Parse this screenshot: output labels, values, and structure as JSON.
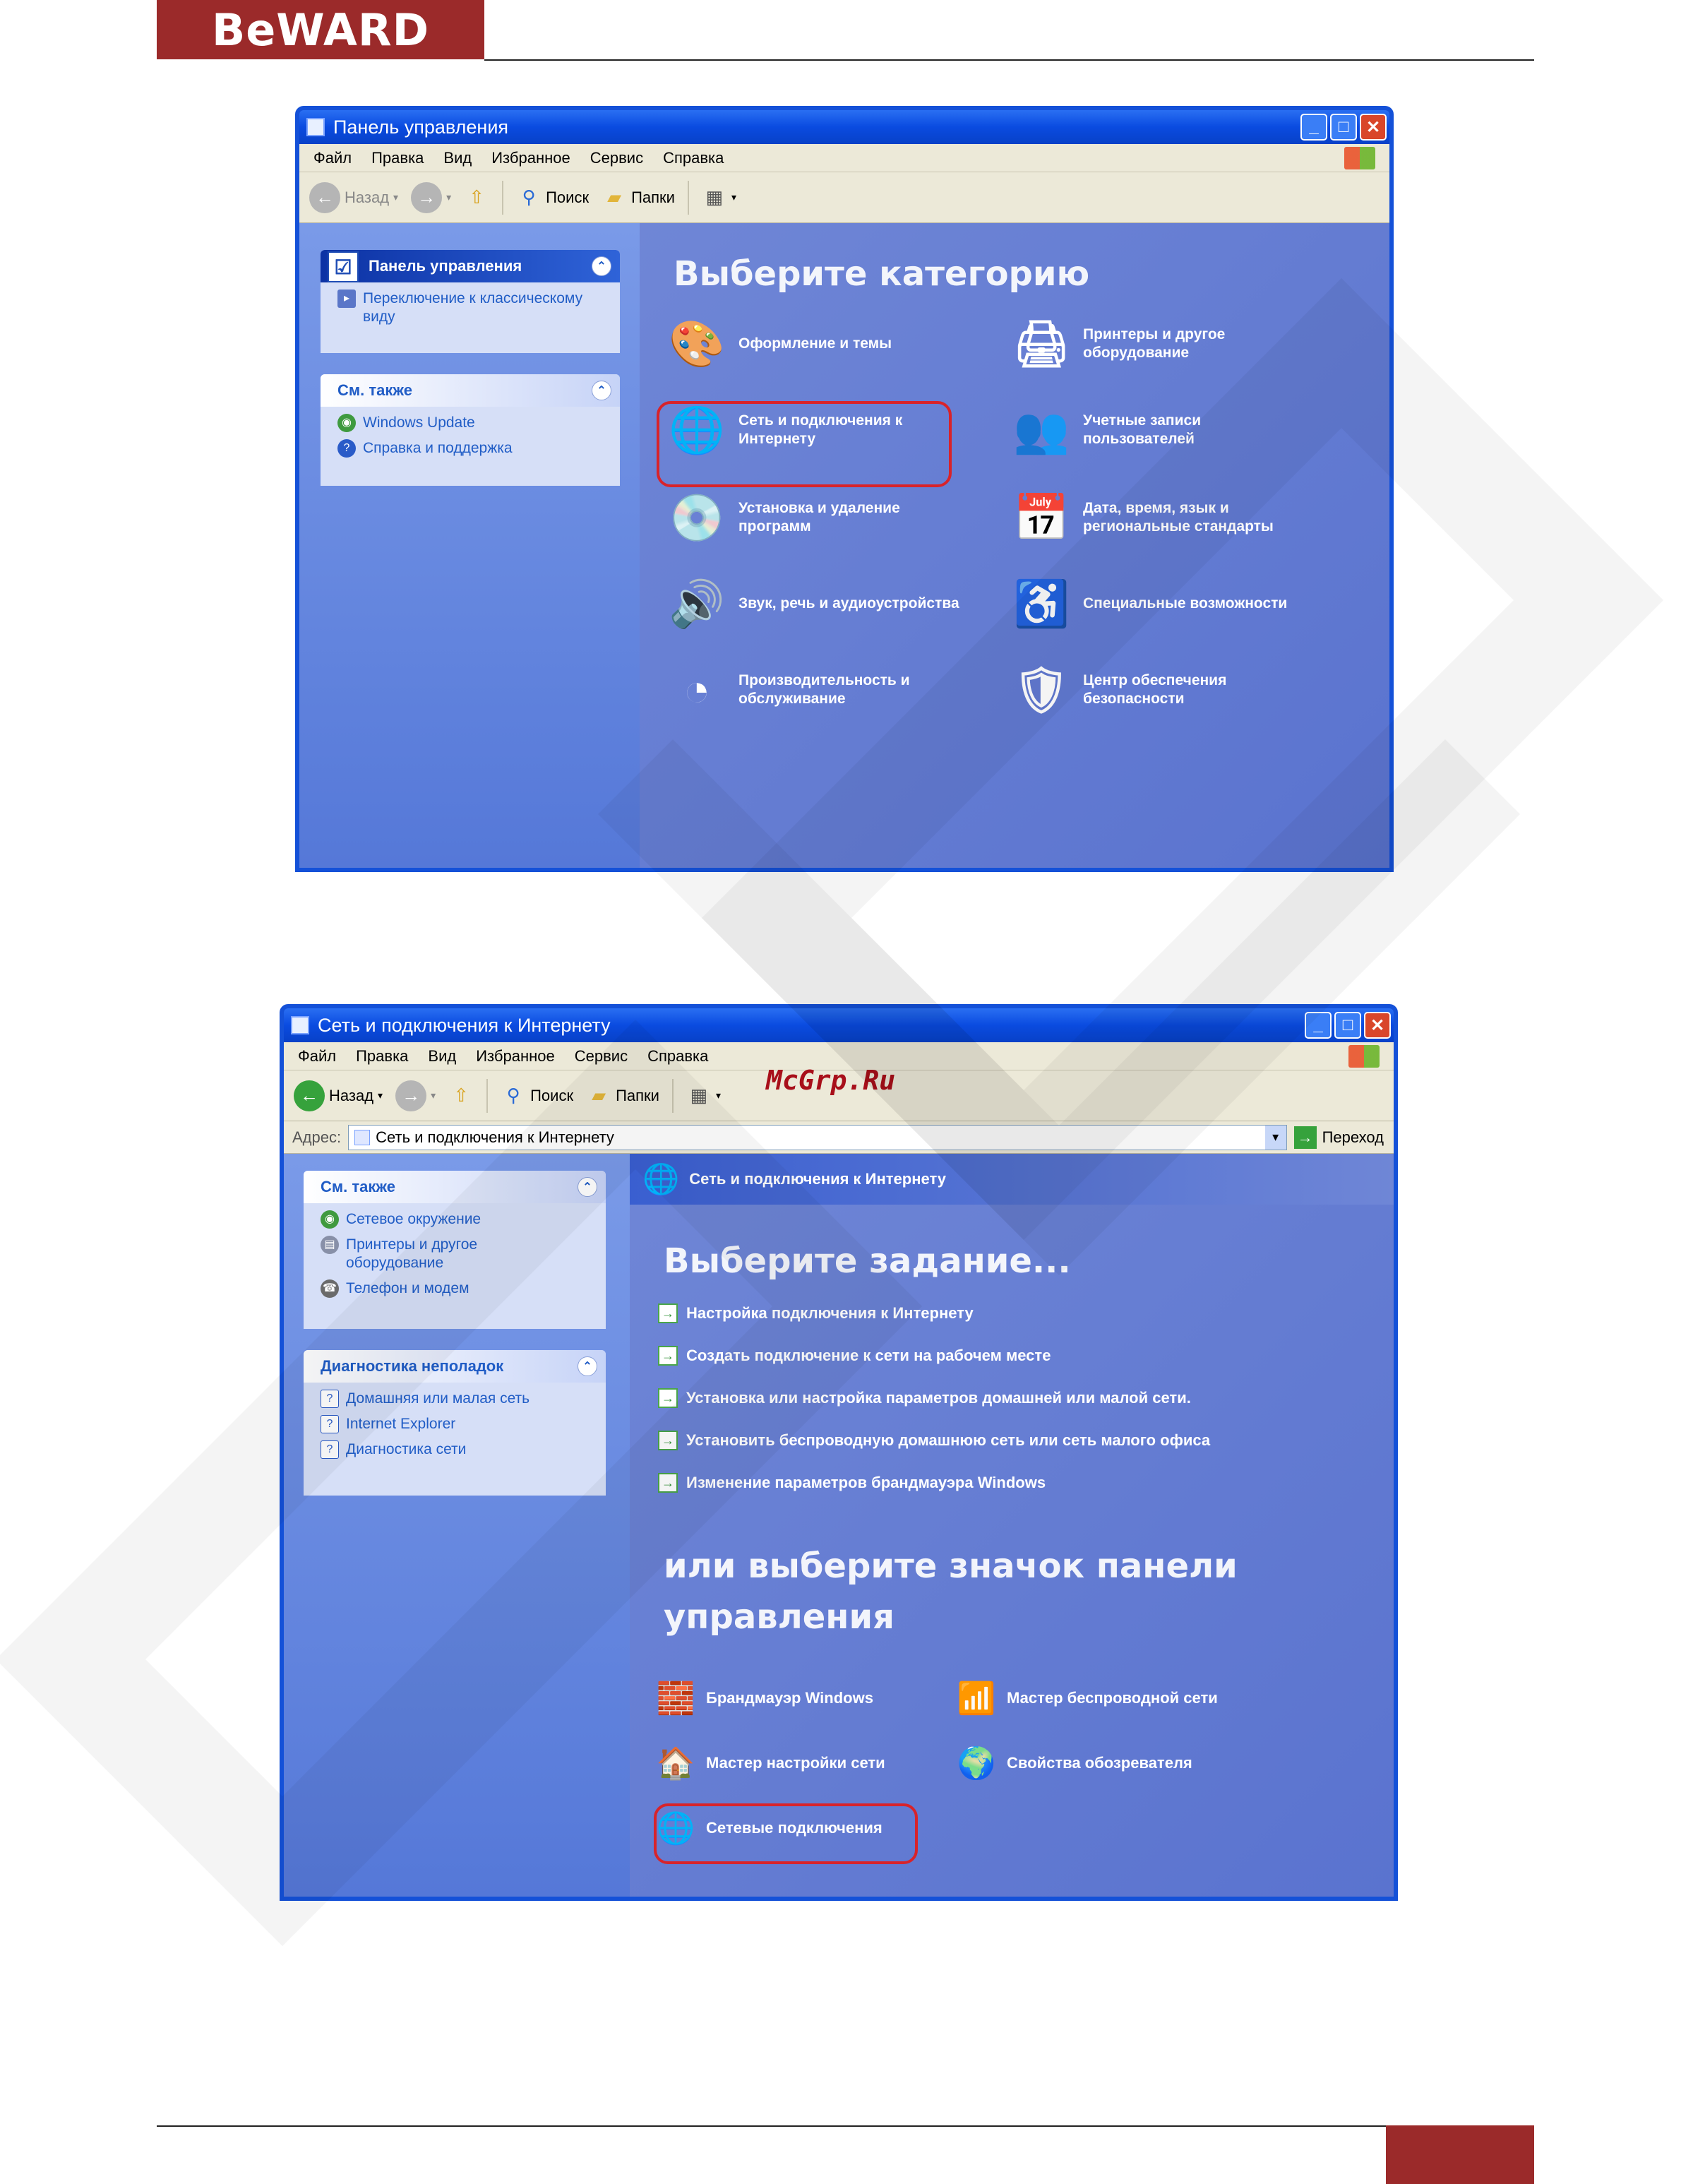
{
  "brand": {
    "logo_text": "BeWARD"
  },
  "watermark": {
    "text": "McGrp.Ru"
  },
  "window1": {
    "title": "Панель управления",
    "menu": [
      "Файл",
      "Правка",
      "Вид",
      "Избранное",
      "Сервис",
      "Справка"
    ],
    "toolbar": {
      "back": "Назад",
      "search": "Поиск",
      "folders": "Папки"
    },
    "left": {
      "panel1_title": "Панель управления",
      "panel1_items": [
        "Переключение к классическому виду"
      ],
      "panel2_title": "См. также",
      "panel2_items": [
        "Windows Update",
        "Справка и поддержка"
      ]
    },
    "heading": "Выберите категорию",
    "categories": [
      {
        "label": "Оформление и темы",
        "icon": "appearance-icon"
      },
      {
        "label": "Принтеры и другое оборудование",
        "icon": "printer-icon"
      },
      {
        "label": "Сеть и подключения к Интернету",
        "icon": "network-icon"
      },
      {
        "label": "Учетные записи пользователей",
        "icon": "users-icon"
      },
      {
        "label": "Установка и удаление программ",
        "icon": "add-remove-icon"
      },
      {
        "label": "Дата, время, язык и региональные стандарты",
        "icon": "date-time-icon"
      },
      {
        "label": "Звук, речь и аудиоустройства",
        "icon": "sound-icon"
      },
      {
        "label": "Специальные возможности",
        "icon": "accessibility-icon"
      },
      {
        "label": "Производительность и обслуживание",
        "icon": "performance-icon"
      },
      {
        "label": "Центр обеспечения безопасности",
        "icon": "security-center-icon"
      }
    ]
  },
  "window2": {
    "title": "Сеть и подключения к Интернету",
    "menu": [
      "Файл",
      "Правка",
      "Вид",
      "Избранное",
      "Сервис",
      "Справка"
    ],
    "toolbar": {
      "back": "Назад",
      "search": "Поиск",
      "folders": "Папки"
    },
    "address": {
      "label": "Адрес:",
      "value": "Сеть и подключения к Интернету",
      "go": "Переход"
    },
    "left": {
      "panel1_title": "См. также",
      "panel1_items": [
        "Сетевое окружение",
        "Принтеры и другое оборудование",
        "Телефон и модем"
      ],
      "panel2_title": "Диагностика неполадок",
      "panel2_items": [
        "Домашняя или малая сеть",
        "Internet Explorer",
        "Диагностика сети"
      ]
    },
    "section_header": "Сеть и подключения к Интернету",
    "task_heading": "Выберите задание...",
    "tasks": [
      "Настройка подключения к Интернету",
      "Создать подключение к сети на рабочем месте",
      "Установка или настройка параметров домашней или малой сети.",
      "Установить беспроводную домашнюю сеть или сеть малого офиса",
      "Изменение параметров брандмауэра Windows"
    ],
    "icons_heading_line1": "или выберите значок панели",
    "icons_heading_line2": "управления",
    "icons": [
      {
        "label": "Брандмауэр Windows",
        "icon": "firewall-icon"
      },
      {
        "label": "Мастер беспроводной сети",
        "icon": "wireless-icon"
      },
      {
        "label": "Мастер настройки сети",
        "icon": "network-setup-icon"
      },
      {
        "label": "Свойства обозревателя",
        "icon": "internet-options-icon"
      },
      {
        "label": "Сетевые подключения",
        "icon": "network-connections-icon"
      }
    ]
  }
}
